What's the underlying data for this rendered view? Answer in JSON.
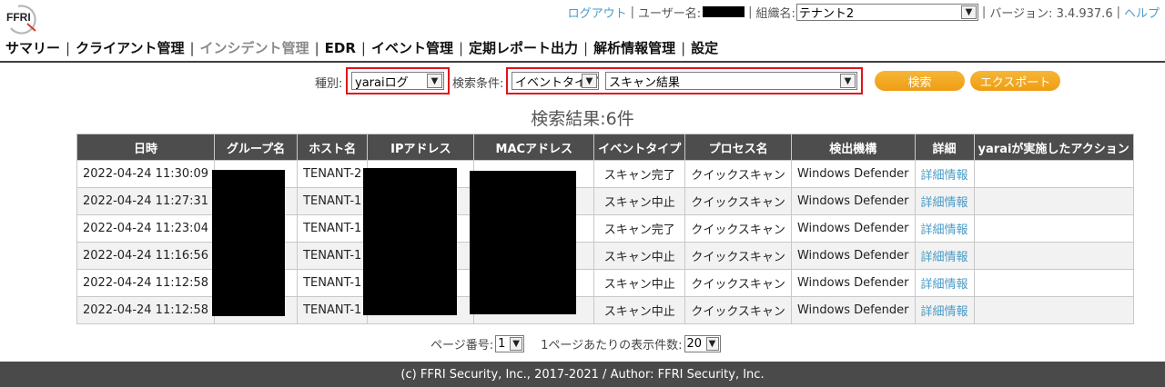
{
  "logo": {
    "text": "FFRI"
  },
  "topbar": {
    "logout": "ログアウト",
    "username_label": "ユーザー名:",
    "org_label": "組織名:",
    "org_value": "テナント2",
    "version": "バージョン: 3.4.937.6",
    "help": "ヘルプ"
  },
  "nav": {
    "items": [
      "サマリー",
      "クライアント管理",
      "インシデント管理",
      "EDR",
      "イベント管理",
      "定期レポート出力",
      "解析情報管理",
      "設定"
    ],
    "active": "インシデント管理"
  },
  "filters": {
    "type_label": "種別:",
    "type_value": "yaraiログ",
    "cond_label": "検索条件:",
    "cond_field_value": "イベントタイプ",
    "cond_value": "スキャン結果",
    "search_button": "検索",
    "export_button": "エクスポート",
    "highlight_color": "#e0141b",
    "button_color": "#f2a51c"
  },
  "results": {
    "summary": "検索結果:6件",
    "columns": [
      "日時",
      "グループ名",
      "ホスト名",
      "IPアドレス",
      "MACアドレス",
      "イベントタイプ",
      "プロセス名",
      "検出機構",
      "詳細",
      "yaraiが実施したアクション"
    ],
    "rows": [
      {
        "datetime": "2022-04-24 11:30:09",
        "host": "TENANT-2",
        "event": "スキャン完了",
        "process": "クイックスキャン",
        "engine": "Windows Defender",
        "detail": "詳細情報"
      },
      {
        "datetime": "2022-04-24 11:27:31",
        "host": "TENANT-1",
        "event": "スキャン中止",
        "process": "クイックスキャン",
        "engine": "Windows Defender",
        "detail": "詳細情報"
      },
      {
        "datetime": "2022-04-24 11:23:04",
        "host": "TENANT-1",
        "event": "スキャン完了",
        "process": "クイックスキャン",
        "engine": "Windows Defender",
        "detail": "詳細情報"
      },
      {
        "datetime": "2022-04-24 11:16:56",
        "host": "TENANT-1",
        "event": "スキャン中止",
        "process": "クイックスキャン",
        "engine": "Windows Defender",
        "detail": "詳細情報"
      },
      {
        "datetime": "2022-04-24 11:12:58",
        "host": "TENANT-1",
        "event": "スキャン中止",
        "process": "クイックスキャン",
        "engine": "Windows Defender",
        "detail": "詳細情報"
      },
      {
        "datetime": "2022-04-24 11:12:58",
        "host": "TENANT-1",
        "event": "スキャン中止",
        "process": "クイックスキャン",
        "engine": "Windows Defender",
        "detail": "詳細情報"
      }
    ]
  },
  "pager": {
    "page_label": "ページ番号:",
    "page_value": "1",
    "per_page_label": "1ページあたりの表示件数:",
    "per_page_value": "20"
  },
  "footer": {
    "text": "(c) FFRI Security, Inc., 2017-2021 / Author: FFRI Security, Inc."
  }
}
